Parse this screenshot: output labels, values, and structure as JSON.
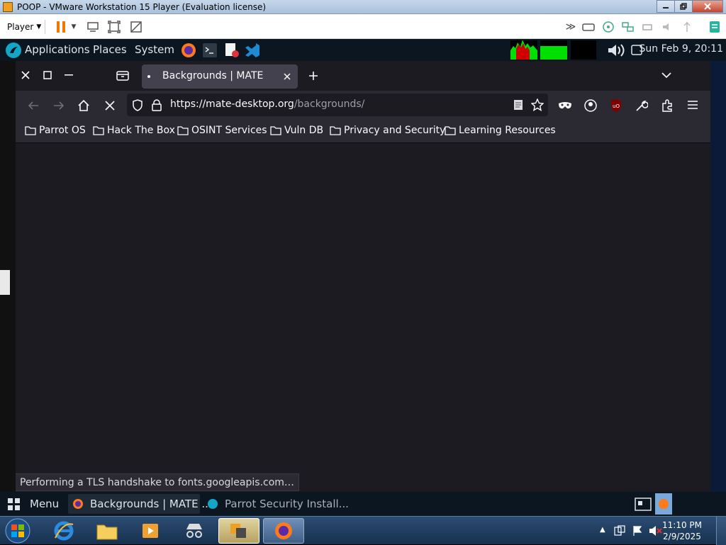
{
  "vm": {
    "title": "POOP - VMware Workstation 15 Player (Evaluation license)",
    "player_menu": "Player"
  },
  "mate_top": {
    "applications": "Applications",
    "places": "Places",
    "system": "System",
    "clock": "Sun Feb  9, 20:11"
  },
  "firefox": {
    "tab_title": "Backgrounds | MATE",
    "url_host": "https://mate-desktop.org",
    "url_path": "/backgrounds/",
    "bookmarks": [
      "Parrot OS",
      "Hack The Box",
      "OSINT Services",
      "Vuln DB",
      "Privacy and Security",
      "Learning Resources"
    ],
    "status": "Performing a TLS handshake to fonts.googleapis.com…"
  },
  "mate_bottom": {
    "menu": "Menu",
    "task1": "Backgrounds | MATE ...",
    "task2": "Parrot Security Install..."
  },
  "windows": {
    "time": "11:10 PM",
    "date": "2/9/2025"
  },
  "colors": {
    "firefox_bg": "#1c1b22",
    "firefox_toolbar": "#2b2a33",
    "mate_panel": "#0c1620",
    "accent": "#00ddff"
  }
}
